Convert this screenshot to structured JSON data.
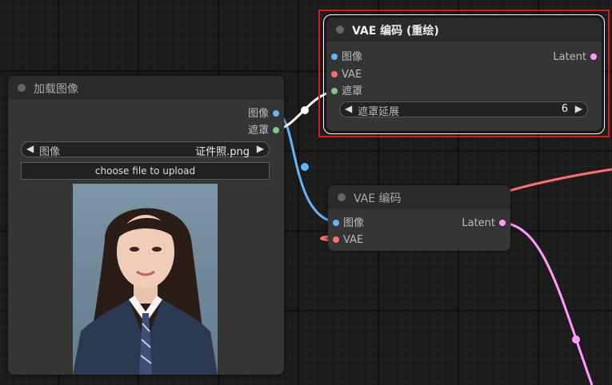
{
  "colors": {
    "image_pin": "#64b5f6",
    "mask_pin": "#81c784",
    "vae_pin": "#ff6e6e",
    "latent_pin": "#ff9cf9",
    "selection_outline": "#d41b1b"
  },
  "load_image_node": {
    "title": "加载图像",
    "outputs": {
      "image": "图像",
      "mask": "遮罩"
    },
    "image_widget": {
      "label": "图像",
      "value": "证件照.png"
    },
    "upload_button": "choose file to upload",
    "preview_icon": "portrait-photo"
  },
  "vae_encode_inpaint_node": {
    "title": "VAE 编码 (重绘)",
    "inputs": {
      "image": "图像",
      "vae": "VAE",
      "mask": "遮罩"
    },
    "output": "Latent",
    "grow_mask_widget": {
      "label": "遮罩延展",
      "value": "6"
    },
    "selected": true
  },
  "vae_encode_node": {
    "title": "VAE 编码",
    "inputs": {
      "image": "图像",
      "vae": "VAE"
    },
    "output": "Latent"
  }
}
